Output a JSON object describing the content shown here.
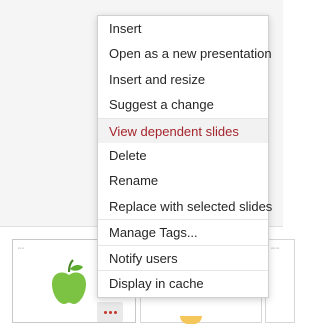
{
  "menu": {
    "items": [
      {
        "label": "Insert"
      },
      {
        "label": "Open as a new presentation"
      },
      {
        "label": "Insert and resize"
      },
      {
        "label": "Suggest a change"
      },
      {
        "label": "View dependent slides"
      },
      {
        "label": "Delete"
      },
      {
        "label": "Rename"
      },
      {
        "label": "Replace with selected slides"
      },
      {
        "label": "Manage Tags..."
      },
      {
        "label": "Notify users"
      },
      {
        "label": "Display in cache"
      }
    ],
    "highlighted_item": "View dependent slides"
  },
  "colors": {
    "highlight_text": "#a4262c",
    "highlight_bg": "#f2f2f2",
    "more_dots": "#c0392b",
    "apple_green": "#7cc243",
    "apple_stem": "#4a8a2a"
  },
  "thumbnails": {
    "more_button_icon": "more-options-icon",
    "slide_icon": "apple-icon"
  }
}
